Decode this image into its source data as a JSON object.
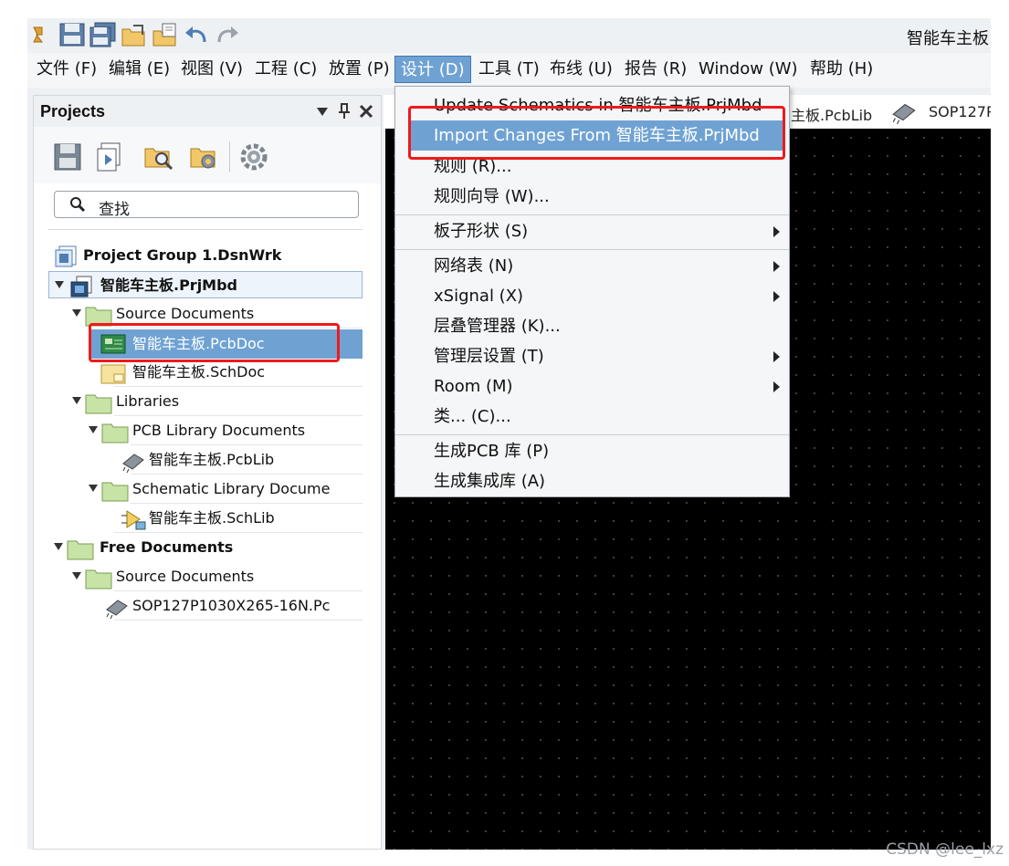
{
  "window": {
    "title": "智能车主板"
  },
  "menubar": {
    "items": [
      {
        "label": "文件 (F)"
      },
      {
        "label": "编辑 (E)"
      },
      {
        "label": "视图 (V)"
      },
      {
        "label": "工程 (C)"
      },
      {
        "label": "放置 (P)"
      },
      {
        "label": "设计 (D)"
      },
      {
        "label": "工具 (T)"
      },
      {
        "label": "布线 (U)"
      },
      {
        "label": "报告 (R)"
      },
      {
        "label": "Window (W)"
      },
      {
        "label": "帮助 (H)"
      }
    ]
  },
  "projects_panel": {
    "title": "Projects",
    "search_placeholder": "查找",
    "tree": [
      {
        "label": "Project Group 1.DsnWrk"
      },
      {
        "label": "智能车主板.PrjMbd"
      },
      {
        "label": "Source Documents"
      },
      {
        "label": "智能车主板.PcbDoc"
      },
      {
        "label": "智能车主板.SchDoc"
      },
      {
        "label": "Libraries"
      },
      {
        "label": "PCB Library Documents"
      },
      {
        "label": "智能车主板.PcbLib"
      },
      {
        "label": "Schematic Library Docume"
      },
      {
        "label": "智能车主板.SchLib"
      },
      {
        "label": "Free Documents"
      },
      {
        "label": "Source Documents"
      },
      {
        "label": "SOP127P1030X265-16N.Pc"
      }
    ]
  },
  "document_tabs": [
    {
      "label": "主板.PcbLib"
    },
    {
      "label": "SOP127P"
    }
  ],
  "design_menu": {
    "items": [
      {
        "label": "Update Schematics in 智能车主板.PrjMbd"
      },
      {
        "label": "Import Changes From 智能车主板.PrjMbd"
      },
      {
        "label": "规则 (R)..."
      },
      {
        "label": "规则向导 (W)..."
      },
      {
        "label": "板子形状 (S)"
      },
      {
        "label": "网络表 (N)"
      },
      {
        "label": "xSignal (X)"
      },
      {
        "label": "层叠管理器 (K)..."
      },
      {
        "label": "管理层设置 (T)"
      },
      {
        "label": "Room (M)"
      },
      {
        "label": "类... (C)..."
      },
      {
        "label": "生成PCB 库 (P)"
      },
      {
        "label": "生成集成库 (A)"
      }
    ]
  },
  "watermark": "CSDN @lee_lxz",
  "colors": {
    "highlight": "#6fa2d3",
    "annotation_red": "#ef1a1a",
    "canvas": "#000000"
  }
}
